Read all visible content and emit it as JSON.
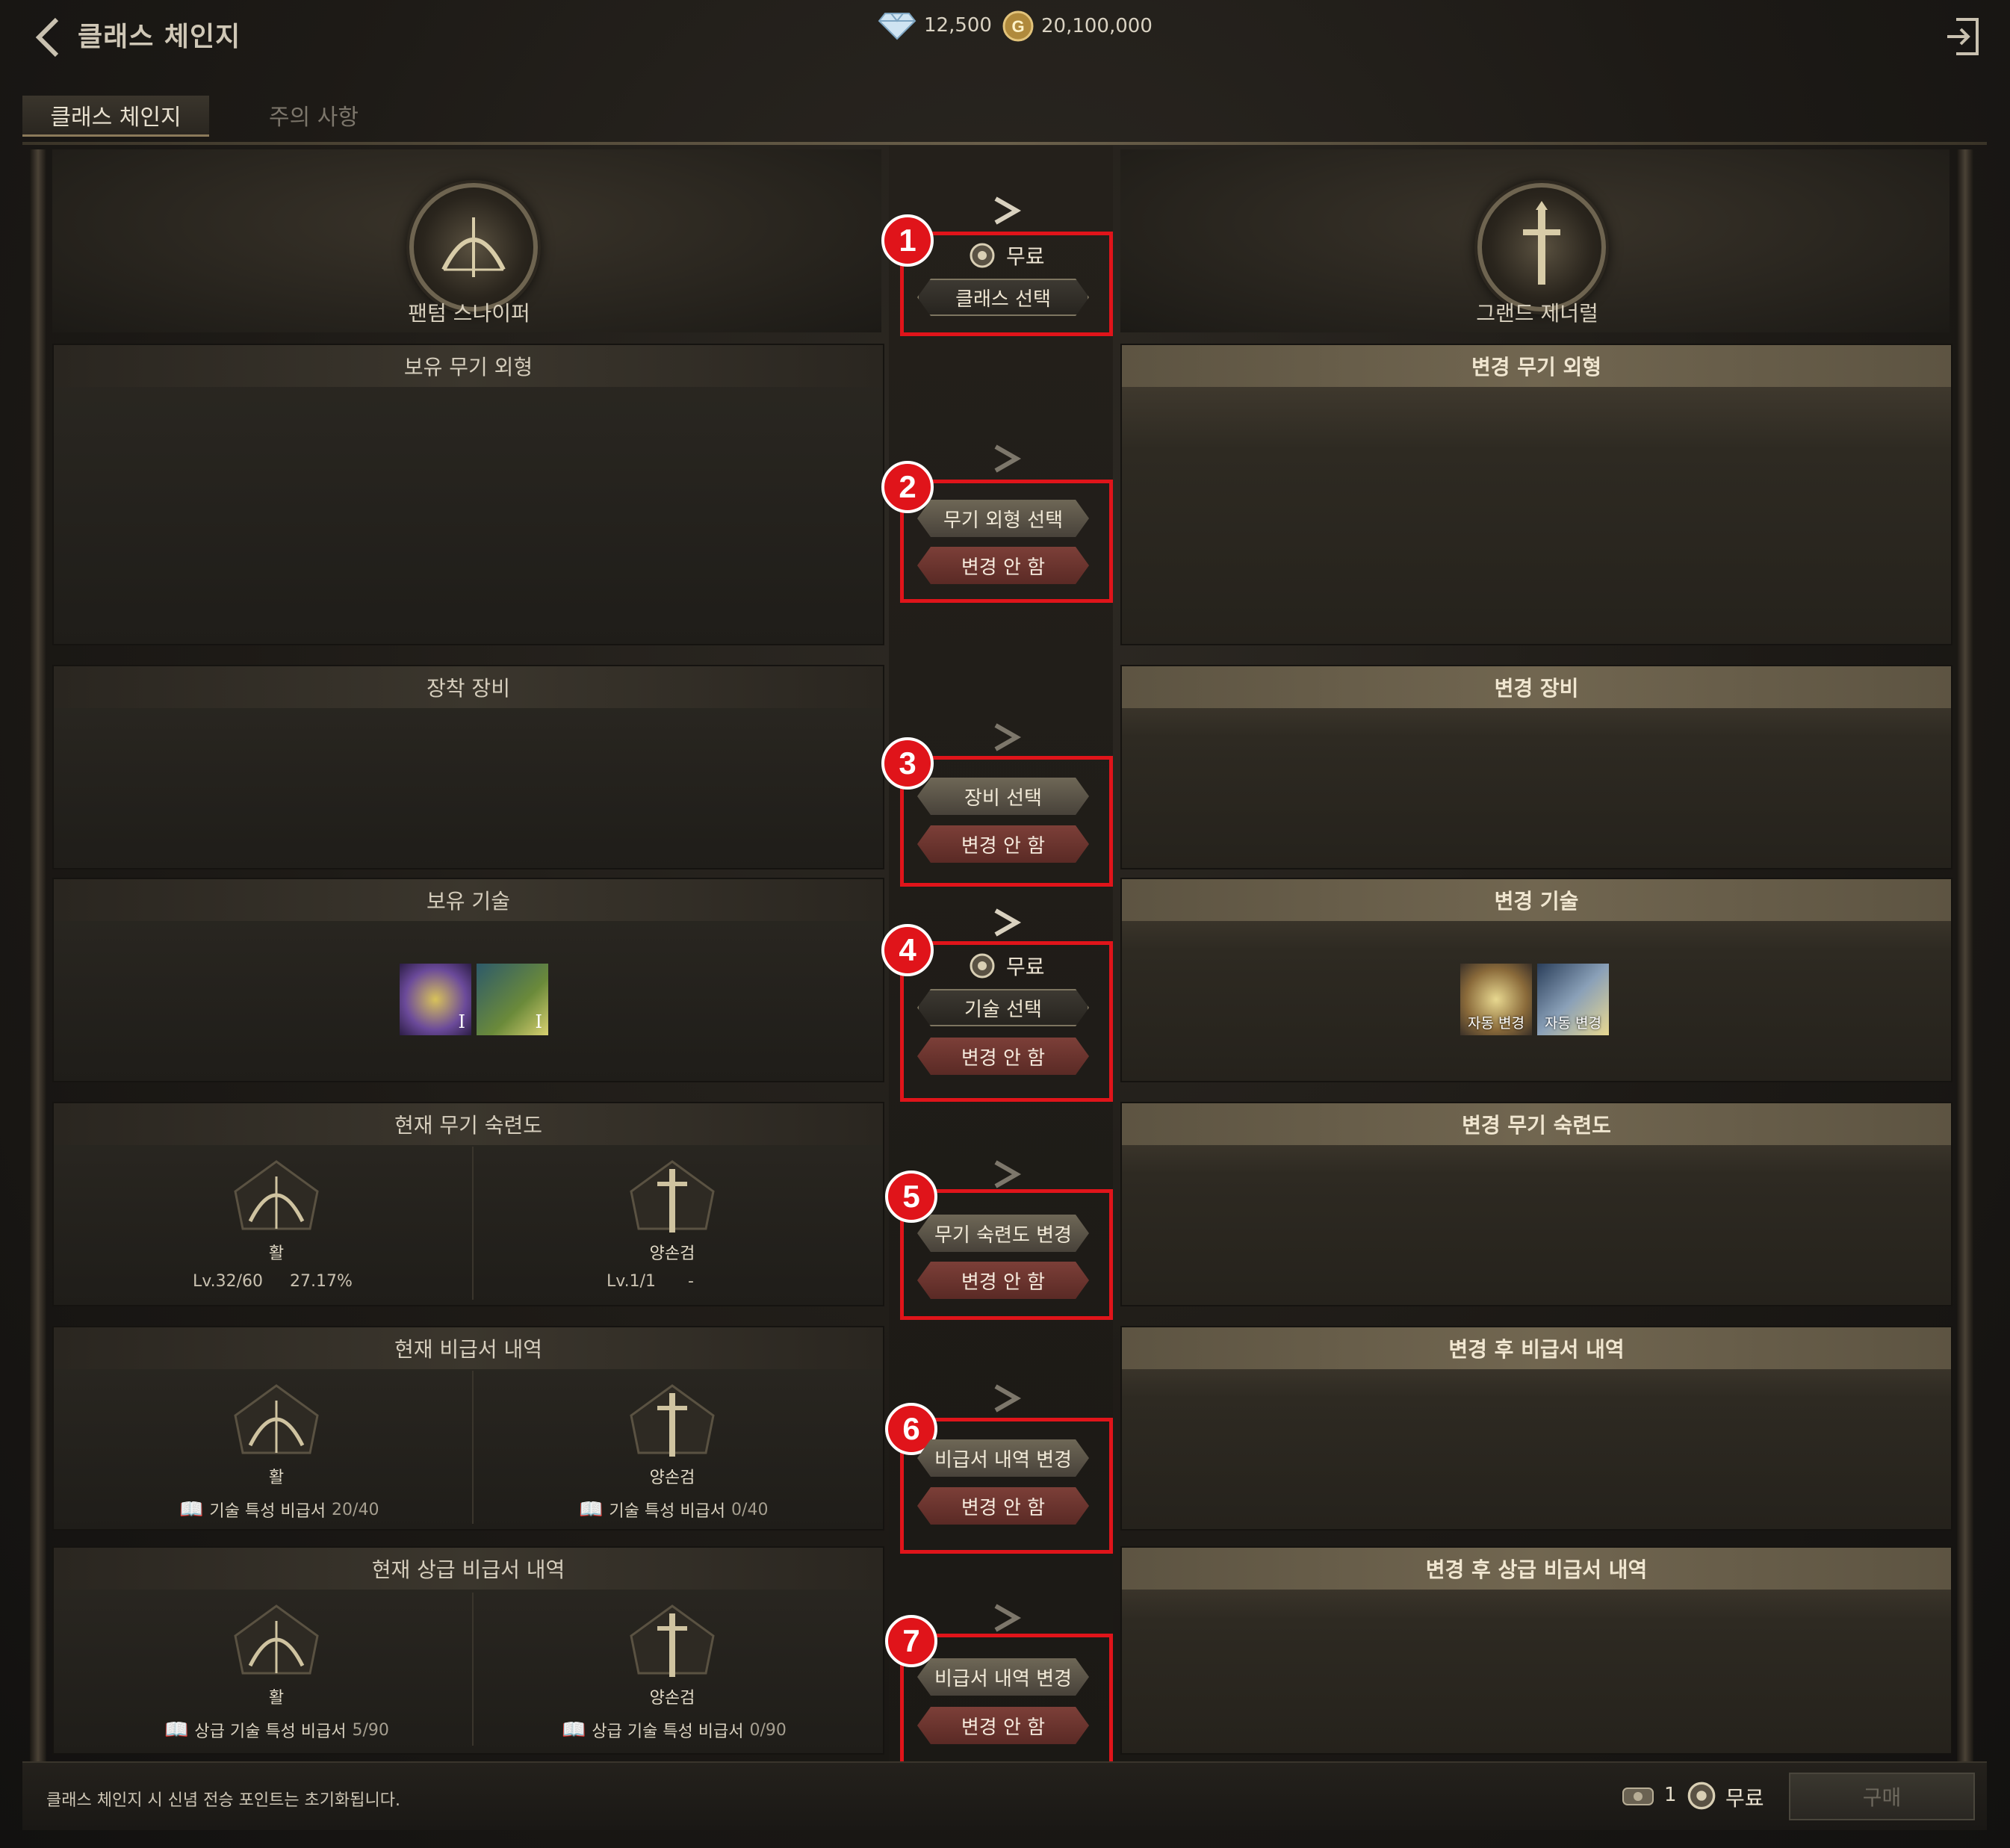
{
  "header": {
    "title": "클래스 체인지",
    "diamonds": "12,500",
    "gold": "20,100,000"
  },
  "tabs": [
    {
      "label": "클래스 체인지",
      "active": true
    },
    {
      "label": "주의 사항",
      "active": false
    }
  ],
  "classes": {
    "current": "팬텀 스나이퍼",
    "target": "그랜드 제너럴"
  },
  "center": {
    "free_label": "무료",
    "class_select": "클래스 선택",
    "no_change": "변경 안 함",
    "weapon_look_select": "무기 외형 선택",
    "equipment_select": "장비 선택",
    "skill_select": "기술 선택",
    "mastery_change": "무기 숙련도 변경",
    "book_change": "비급서 내역 변경",
    "upper_book_change": "비급서 내역 변경"
  },
  "annotations": [
    "1",
    "2",
    "3",
    "4",
    "5",
    "6",
    "7"
  ],
  "sections": {
    "weapon_look": {
      "left": "보유 무기 외형",
      "right": "변경 무기 외형"
    },
    "equipment": {
      "left": "장착 장비",
      "right": "변경 장비"
    },
    "skills": {
      "left": "보유 기술",
      "right": "변경 기술",
      "owned": [
        {
          "icon": "eye-skill-icon",
          "badge": "I"
        },
        {
          "icon": "arrow-skill-icon",
          "badge": "I"
        }
      ],
      "changed": [
        {
          "icon": "sword-skill-icon",
          "label": "자동 변경"
        },
        {
          "icon": "blade-skill-icon",
          "label": "자동 변경"
        }
      ]
    },
    "mastery": {
      "left": "현재 무기 숙련도",
      "right": "변경 무기 숙련도",
      "weapons": [
        {
          "name": "활",
          "level": "Lv.32/60",
          "percent": "27.17%"
        },
        {
          "name": "양손검",
          "level": "Lv.1/1",
          "percent": "-"
        }
      ]
    },
    "books": {
      "left": "현재 비급서 내역",
      "right": "변경 후 비급서 내역",
      "weapons": [
        {
          "name": "활",
          "book": "기술 특성 비급서",
          "count": "20/40"
        },
        {
          "name": "양손검",
          "book": "기술 특성 비급서",
          "count": "0/40"
        }
      ]
    },
    "upper_books": {
      "left": "현재 상급 비급서 내역",
      "right": "변경 후 상급 비급서 내역",
      "weapons": [
        {
          "name": "활",
          "book": "상급 기술 특성 비급서",
          "count": "5/90"
        },
        {
          "name": "양손검",
          "book": "상급 기술 특성 비급서",
          "count": "0/90"
        }
      ]
    }
  },
  "footer": {
    "notice": "클래스 체인지 시 신념 전승 포인트는 초기화됩니다.",
    "ticket_count": "1",
    "price": "무료",
    "buy": "구매"
  },
  "colors": {
    "highlight": "#e0141a",
    "accent": "#716650"
  }
}
